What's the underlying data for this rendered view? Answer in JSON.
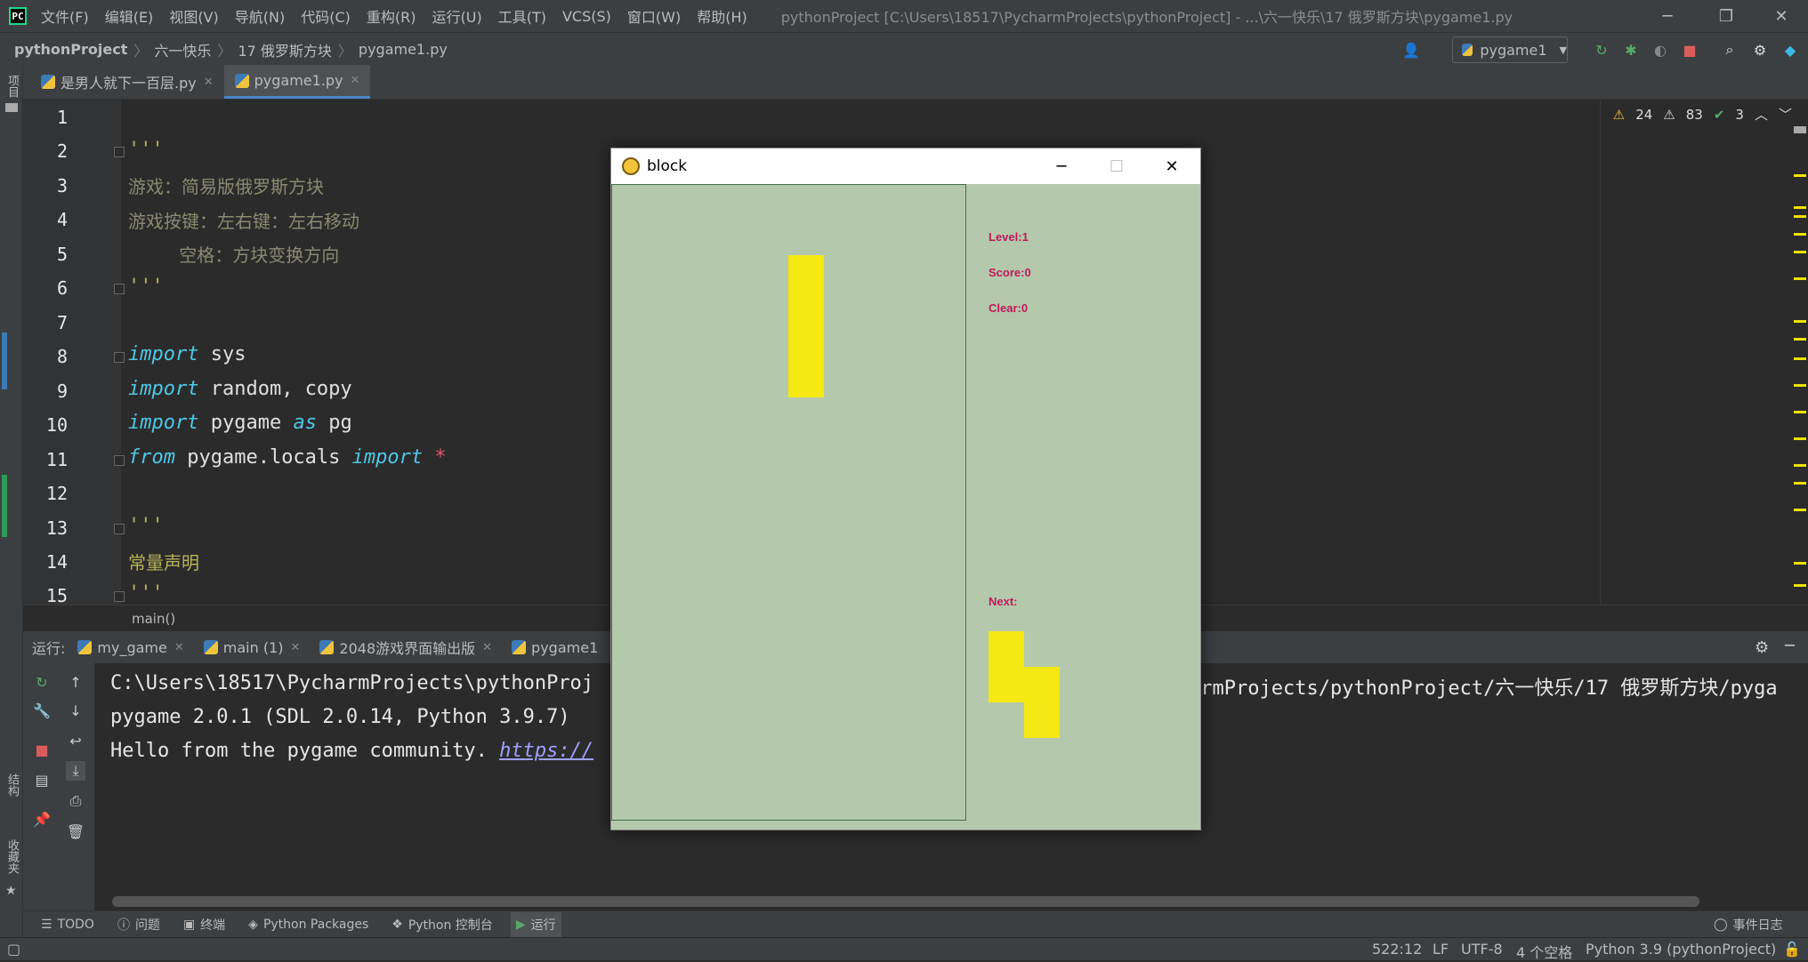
{
  "menubar": {
    "items": [
      "文件(F)",
      "编辑(E)",
      "视图(V)",
      "导航(N)",
      "代码(C)",
      "重构(R)",
      "运行(U)",
      "工具(T)",
      "VCS(S)",
      "窗口(W)",
      "帮助(H)"
    ],
    "window_title": "pythonProject [C:\\Users\\18517\\PycharmProjects\\pythonProject] - ...\\六一快乐\\17 俄罗斯方块\\pygame1.py"
  },
  "navbar": {
    "crumbs": [
      "pythonProject",
      "六一快乐",
      "17 俄罗斯方块",
      "pygame1.py"
    ],
    "run_config": "pygame1"
  },
  "left_stripe": {
    "project": "项目",
    "structure": "结构",
    "favorites": "收藏夹"
  },
  "tabs": [
    {
      "label": "是男人就下一百层.py",
      "active": false
    },
    {
      "label": "pygame1.py",
      "active": true
    }
  ],
  "inspection": {
    "warnings": "24",
    "weak_warnings": "83",
    "ok": "3"
  },
  "editor": {
    "line_numbers": [
      "1",
      "2",
      "3",
      "4",
      "5",
      "6",
      "7",
      "8",
      "9",
      "10",
      "11",
      "12",
      "13",
      "14",
      "15"
    ],
    "lines": {
      "l2": "'''",
      "l3": "游戏：简易版俄罗斯方块",
      "l4": "游戏按键：左右键：左右移动",
      "l5": "         空格：方块变换方向",
      "l6": "'''",
      "l8_kw": "import",
      "l8_rest": " sys",
      "l9_kw": "import",
      "l9_rest": " random, copy",
      "l10_kw": "import",
      "l10_mid": " pygame ",
      "l10_kw2": "as",
      "l10_rest": " pg",
      "l11_kw": "from",
      "l11_mid": " pygame.locals ",
      "l11_kw2": "import",
      "l11_star": " *",
      "l13": "'''",
      "l14": "常量声明",
      "l15": "'''"
    },
    "function_breadcrumb": "main()"
  },
  "run_panel": {
    "label": "运行:",
    "tabs": [
      "my_game",
      "main (1)",
      "2048游戏界面输出版",
      "pygame1"
    ],
    "console": {
      "line1_left": "C:\\Users\\18517\\PycharmProjects\\pythonProj",
      "line1_right": "armProjects/pythonProject/六一快乐/17 俄罗斯方块/pyga",
      "line2": "pygame 2.0.1 (SDL 2.0.14, Python 3.9.7)",
      "line3_text": "Hello from the pygame community. ",
      "line3_link": "https://"
    }
  },
  "bottom_tools": [
    "TODO",
    "问题",
    "终端",
    "Python Packages",
    "Python 控制台",
    "运行"
  ],
  "event_log": "事件日志",
  "status": {
    "position": "522:12",
    "line_sep": "LF",
    "encoding": "UTF-8",
    "indent": "4 个空格",
    "interpreter": "Python 3.9 (pythonProject)"
  },
  "game_window": {
    "title": "block",
    "hud": {
      "level": "Level:1",
      "score": "Score:0",
      "clear": "Clear:0",
      "next": "Next:"
    },
    "colors": {
      "background": "#b4c9ab",
      "block": "#f5e813",
      "hud_text": "#c2185b",
      "border": "#3f6f48"
    },
    "current_piece": "I (vertical)",
    "next_piece": "S (vertical)"
  }
}
